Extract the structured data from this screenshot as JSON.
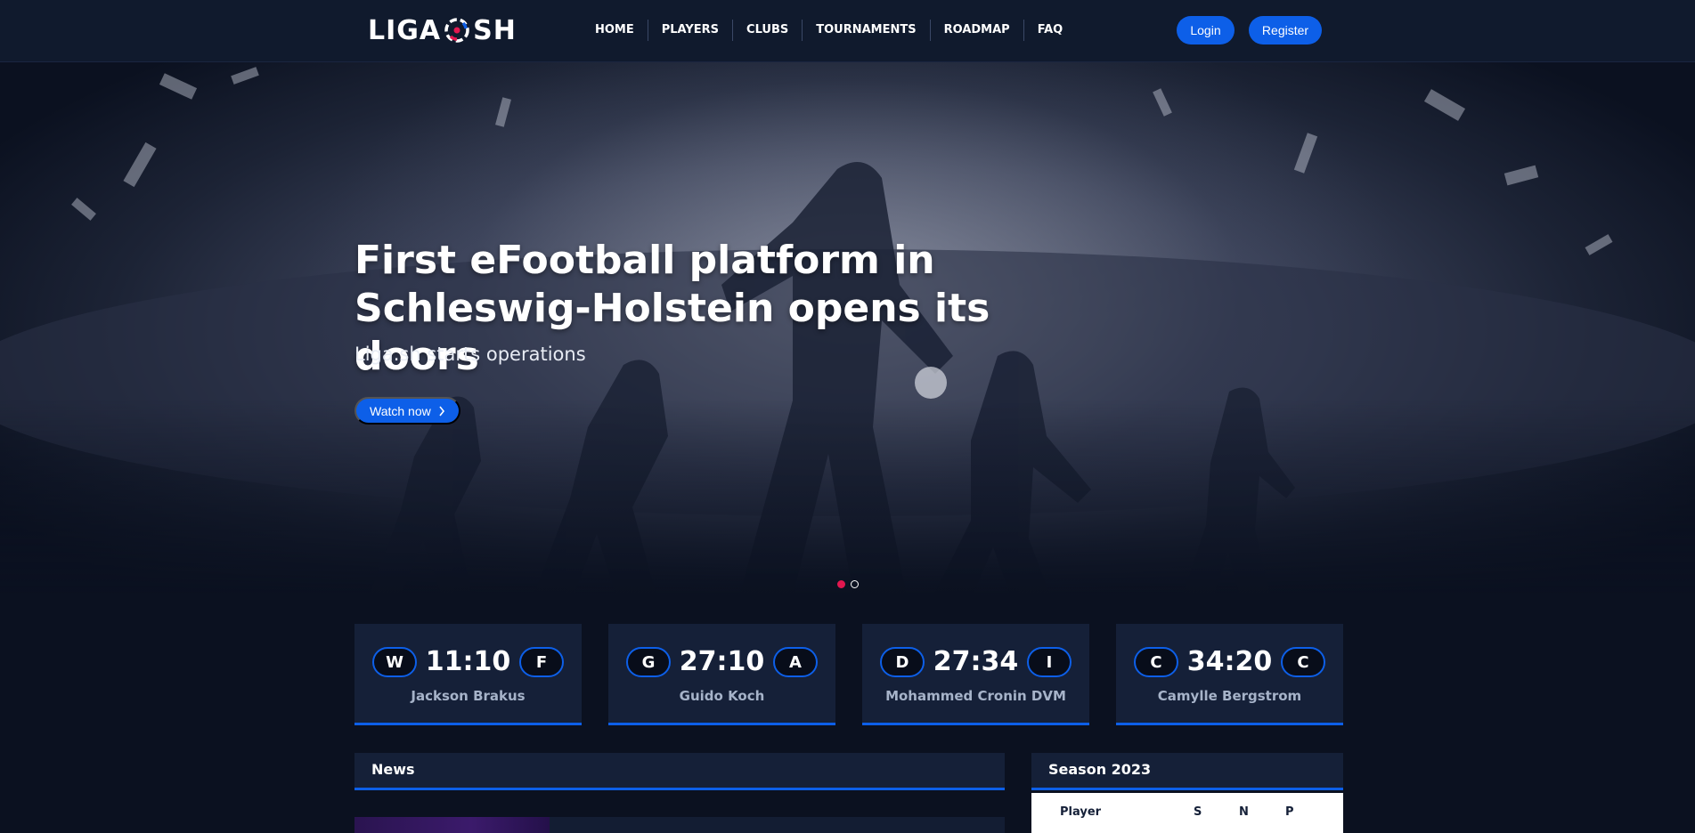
{
  "brand": {
    "logo_left": "LIGA",
    "logo_right": "SH"
  },
  "nav": {
    "items": [
      "HOME",
      "PLAYERS",
      "CLUBS",
      "TOURNAMENTS",
      "ROADMAP",
      "FAQ"
    ],
    "login_label": "Login",
    "register_label": "Register"
  },
  "hero": {
    "title": "First eFootball platform in Schleswig-Holstein opens its doors",
    "subtitle": "Liga.sh starts operations",
    "cta_label": "Watch now",
    "slides": {
      "count": 2,
      "active": 1
    }
  },
  "matches": [
    {
      "left": "W",
      "score": "11:10",
      "right": "F",
      "name": "Jackson Brakus"
    },
    {
      "left": "G",
      "score": "27:10",
      "right": "A",
      "name": "Guido Koch"
    },
    {
      "left": "D",
      "score": "27:34",
      "right": "I",
      "name": "Mohammed Cronin DVM"
    },
    {
      "left": "C",
      "score": "34:20",
      "right": "C",
      "name": "Camylle Bergstrom"
    }
  ],
  "news": {
    "title": "News"
  },
  "season": {
    "title": "Season 2023",
    "columns": [
      "Player",
      "S",
      "N",
      "P"
    ]
  },
  "colors": {
    "accent": "#0d5fe8",
    "active_dot": "#e2174f",
    "navbar": "#101a2d",
    "card": "#152038"
  }
}
